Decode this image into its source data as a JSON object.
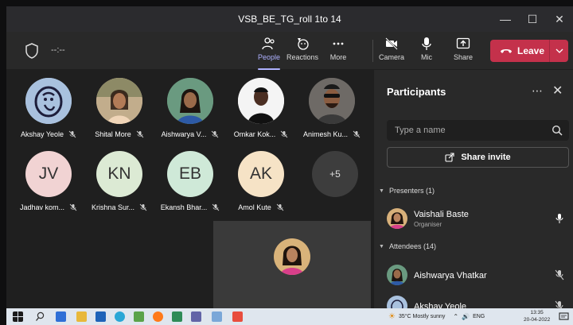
{
  "window": {
    "title": "VSB_BE_TG_roll 1to 14"
  },
  "toolbar": {
    "timer": "--:--",
    "people_label": "People",
    "reactions_label": "Reactions",
    "more_label": "More",
    "camera_label": "Camera",
    "mic_label": "Mic",
    "share_label": "Share",
    "leave_label": "Leave",
    "accent": "#aeb1ff",
    "leave_color": "#c4314b"
  },
  "stage": {
    "tiles": [
      {
        "name": "Akshay Yeole",
        "initials": "",
        "avatar": "ganesha-art"
      },
      {
        "name": "Shital More",
        "initials": "",
        "avatar": "photo"
      },
      {
        "name": "Aishwarya V...",
        "initials": "",
        "avatar": "photo"
      },
      {
        "name": "Omkar Kok...",
        "initials": "",
        "avatar": "photo"
      },
      {
        "name": "Animesh Ku...",
        "initials": "",
        "avatar": "photo"
      },
      {
        "name": "Jadhav kom...",
        "initials": "JV",
        "color": "#f1d3d3"
      },
      {
        "name": "Krishna Sur...",
        "initials": "KN",
        "color": "#dcead4"
      },
      {
        "name": "Ekansh Bhar...",
        "initials": "EB",
        "color": "#cfe9d8"
      },
      {
        "name": "Amol Kute",
        "initials": "AK",
        "color": "#f6e3c6"
      }
    ],
    "overflow_count": "+5"
  },
  "participants": {
    "title": "Participants",
    "search_placeholder": "Type a name",
    "share_invite_label": "Share invite",
    "presenters_header": "Presenters (1)",
    "presenters": [
      {
        "name": "Vaishali Baste",
        "role": "Organiser"
      }
    ],
    "attendees_header": "Attendees (14)",
    "attendees": [
      {
        "name": "Aishwarya Vhatkar"
      },
      {
        "name": "Akshay Yeole"
      }
    ]
  },
  "taskbar": {
    "weather": "35°C  Mostly sunny",
    "lang": "ENG",
    "time": "13:35",
    "date": "20-04-2022"
  }
}
